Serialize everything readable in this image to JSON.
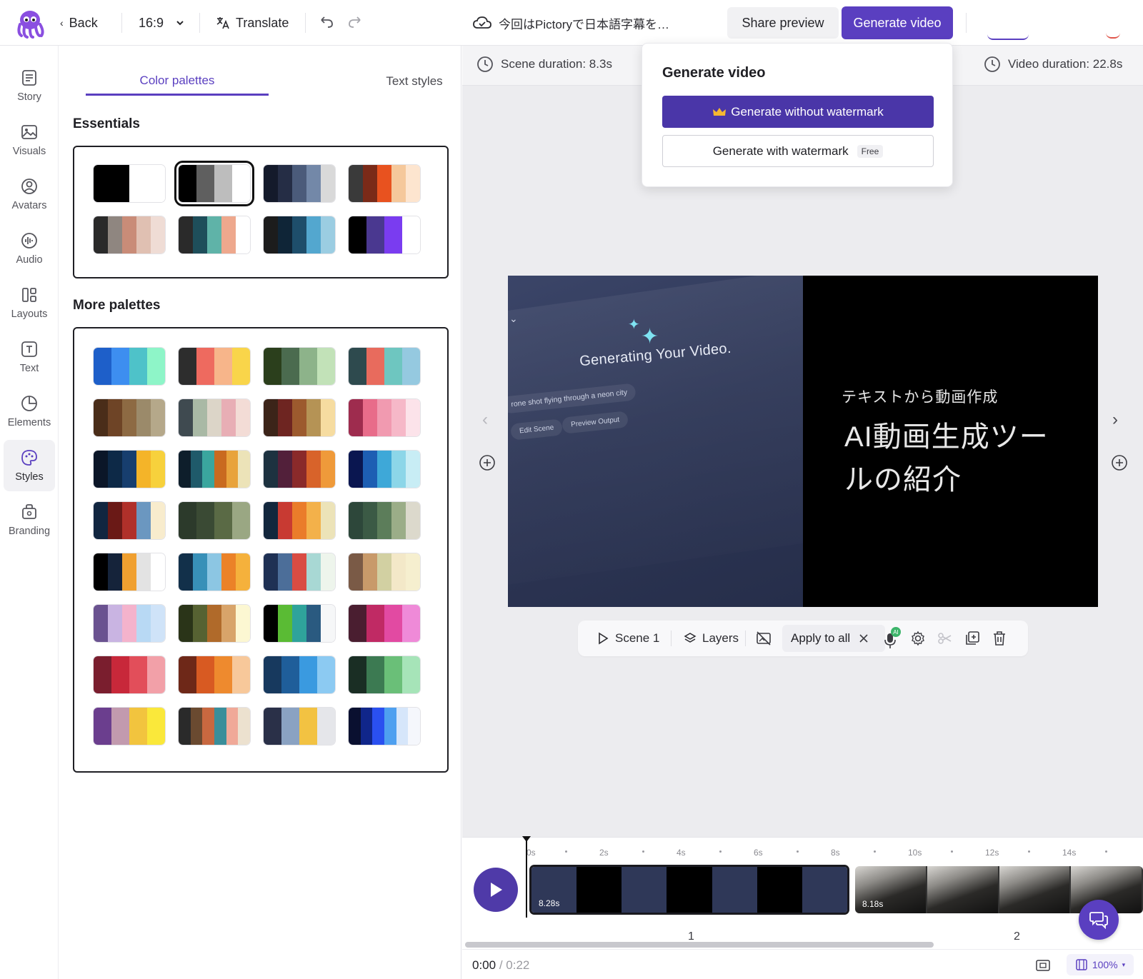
{
  "colors": {
    "accent": "#5a3fc0",
    "accent_dark": "#4a36a8",
    "canvas_bg": "#ececef"
  },
  "topbar": {
    "back_label": "Back",
    "aspect_ratio": "16:9",
    "translate_label": "Translate",
    "project_title": "今回はPictoryで日本語字幕を…",
    "share_preview_label": "Share preview",
    "generate_video_label": "Generate video"
  },
  "rail": [
    {
      "label": "Story",
      "icon": "story-icon"
    },
    {
      "label": "Visuals",
      "icon": "image-icon"
    },
    {
      "label": "Avatars",
      "icon": "avatar-icon"
    },
    {
      "label": "Audio",
      "icon": "audio-icon"
    },
    {
      "label": "Layouts",
      "icon": "layout-icon"
    },
    {
      "label": "Text",
      "icon": "text-icon"
    },
    {
      "label": "Elements",
      "icon": "elements-icon"
    },
    {
      "label": "Styles",
      "icon": "palette-icon",
      "active": true
    },
    {
      "label": "Branding",
      "icon": "branding-icon"
    }
  ],
  "panel": {
    "tab_color_palettes": "Color palettes",
    "tab_text_styles": "Text styles",
    "essentials_title": "Essentials",
    "more_title": "More palettes",
    "essentials": [
      [
        "#000000",
        "#000000",
        "#ffffff",
        "#ffffff"
      ],
      [
        "#000000",
        "#5f5f5f",
        "#bdbdbd",
        "#ffffff"
      ],
      [
        "#141a2b",
        "#252d45",
        "#4b5b7a",
        "#7388a8",
        "#d9d9d9"
      ],
      [
        "#3a3a3a",
        "#7a2a18",
        "#e8521f",
        "#f5c89b",
        "#fde5cf"
      ],
      [
        "#2a2a2a",
        "#8f8680",
        "#c98c78",
        "#e0c0b2",
        "#efdcd5"
      ],
      [
        "#2a2a2a",
        "#1e4e5a",
        "#5fb3a8",
        "#eea88d",
        "#ffffff"
      ],
      [
        "#1c1c1c",
        "#0f2537",
        "#1e4e6b",
        "#53a7cf",
        "#9bcde2"
      ],
      [
        "#000000",
        "#4a3890",
        "#7a3cf0",
        "#ffffff"
      ]
    ],
    "more": [
      [
        "#1e5fc9",
        "#3d8ef0",
        "#4ec2c9",
        "#8ef5c8"
      ],
      [
        "#2d2d2d",
        "#ee6a5f",
        "#f7b58a",
        "#f9d54a"
      ],
      [
        "#2b3f1c",
        "#4b6b4f",
        "#8db38a",
        "#c2e2b8"
      ],
      [
        "#2e4a4e",
        "#e86b5d",
        "#6ec6c0",
        "#95c9e0"
      ],
      [
        "#4a2d19",
        "#6e4426",
        "#8d6a43",
        "#9b8a6a",
        "#b5a88a"
      ],
      [
        "#3f4a50",
        "#a9b9a5",
        "#dcd5c8",
        "#e8aeb5",
        "#f3dcd6"
      ],
      [
        "#3c2419",
        "#6e2521",
        "#9c5a2e",
        "#b59355",
        "#f6dca0"
      ],
      [
        "#9e2c4e",
        "#e86c8a",
        "#f19ab0",
        "#f6b8c8",
        "#fce3ea"
      ],
      [
        "#0b1628",
        "#0d2947",
        "#173e6e",
        "#f4b429",
        "#f7d13c"
      ],
      [
        "#0e1e2b",
        "#1f5a6a",
        "#3aa69e",
        "#c96a1f",
        "#e8a33c",
        "#ece3b8"
      ],
      [
        "#1d3240",
        "#52203a",
        "#8a2a2a",
        "#d8632a",
        "#ef9a3a"
      ],
      [
        "#0a1650",
        "#1d5eb3",
        "#3ea8d8",
        "#8cd6e8",
        "#c8edf5"
      ],
      [
        "#112640",
        "#6a1916",
        "#b0302a",
        "#6b97c0",
        "#f8eccd"
      ],
      [
        "#2c3a2b",
        "#3a4a34",
        "#5a6a45",
        "#9aa783"
      ],
      [
        "#13273d",
        "#c83a32",
        "#ea7c2a",
        "#f3b14a",
        "#ece3b8"
      ],
      [
        "#2d473a",
        "#3b5a45",
        "#5c7d5a",
        "#9bad88",
        "#dcd9cc"
      ],
      [
        "#000000",
        "#15233a",
        "#f0a030",
        "#e3e3e3",
        "#ffffff"
      ],
      [
        "#12304a",
        "#3890b8",
        "#8cc6e3",
        "#eb8228",
        "#f5b13c"
      ],
      [
        "#1f3154",
        "#4c6e99",
        "#d94c43",
        "#a8d8d4",
        "#eef5ec"
      ],
      [
        "#7a5a46",
        "#c89a6a",
        "#d2d0a2",
        "#f3e8c8",
        "#f6efcf"
      ],
      [
        "#6a5290",
        "#c9b4e2",
        "#f4b3cc",
        "#b8d9f4",
        "#cfe3f8"
      ],
      [
        "#2a3418",
        "#566232",
        "#b06a2a",
        "#d8a46a",
        "#fcf7d2"
      ],
      [
        "#000000",
        "#5abb34",
        "#2fa39b",
        "#2a5a80",
        "#f6f7f8"
      ],
      [
        "#4a1e30",
        "#c02a64",
        "#e24aa2",
        "#ef8ad8"
      ],
      [
        "#7a1e2e",
        "#c8283a",
        "#e24e5a",
        "#f2a0a8"
      ],
      [
        "#6e2818",
        "#d85a22",
        "#ee8a2e",
        "#f7c89a"
      ],
      [
        "#17395e",
        "#1f5e9a",
        "#3a9ae0",
        "#8ccaf2"
      ],
      [
        "#1a2e24",
        "#3c7a52",
        "#6abf78",
        "#a6e4b8"
      ],
      [
        "#6b3e8e",
        "#c29aae",
        "#f2c43e",
        "#fae83a"
      ],
      [
        "#2a2a2a",
        "#6a4a30",
        "#c86840",
        "#3a8e9a",
        "#f0a998",
        "#ece1cf"
      ],
      [
        "#2a3048",
        "#8aa2c2",
        "#f2c242",
        "#e5e6ea"
      ],
      [
        "#0a1030",
        "#10268a",
        "#2a50f0",
        "#4ea0f0",
        "#d6e6fa",
        "#f5f7fc"
      ]
    ]
  },
  "editor": {
    "scene_duration": "Scene duration: 8.3s",
    "video_duration": "Video duration: 22.8s",
    "preview_left": {
      "generating_text": "Generating Your Video.",
      "chip_prompt": "rone shot flying through a neon city",
      "chip_edit": "Edit Scene",
      "chip_preview": "Preview Output"
    },
    "preview_right": {
      "subtitle": "テキストから動画作成",
      "title": "AI動画生成ツールの紹介"
    },
    "scene_bar": {
      "scene_label": "Scene 1",
      "layers_label": "Layers",
      "apply_all_label": "Apply to all",
      "ai_badge": "AI"
    }
  },
  "timeline": {
    "ticks": [
      "0s",
      "2s",
      "4s",
      "6s",
      "8s",
      "10s",
      "12s",
      "14s"
    ],
    "clips": [
      {
        "duration": "8.28s",
        "scene": "1"
      },
      {
        "duration": "8.18s",
        "scene": "2"
      }
    ],
    "current_time": "0:00",
    "total_time": "/ 0:22",
    "zoom": "100%"
  },
  "dropdown": {
    "title": "Generate video",
    "primary_label": "Generate without watermark",
    "secondary_label": "Generate with watermark",
    "free_badge": "Free"
  }
}
